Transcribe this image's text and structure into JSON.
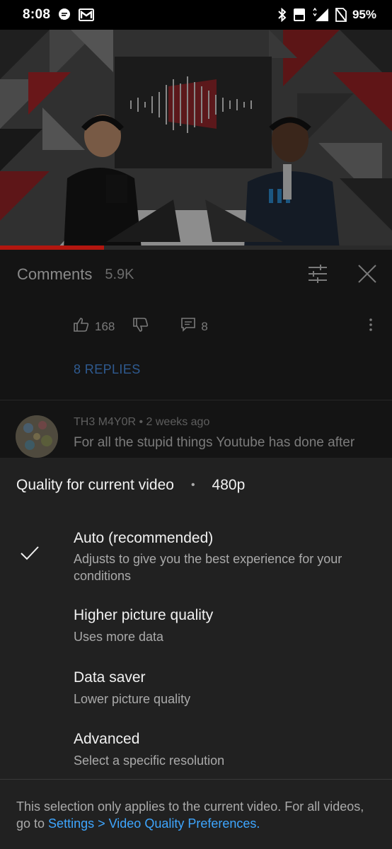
{
  "status_bar": {
    "time": "8:08",
    "battery": "95%",
    "icons": [
      "chat-bubble-icon",
      "gmail-icon",
      "bluetooth-icon",
      "volte-icon",
      "signal-4g-icon",
      "no-sim-icon"
    ]
  },
  "video": {
    "progress": 0.265
  },
  "comments": {
    "title": "Comments",
    "count": "5.9K",
    "likes": "168",
    "replies_count": "8",
    "replies_label": "8 REPLIES",
    "author_meta": "TH3 M4Y0R • 2 weeks ago",
    "text": "For all the stupid things Youtube has done after"
  },
  "quality_sheet": {
    "header": "Quality for current video",
    "dot": "•",
    "current": "480p",
    "options": [
      {
        "title": "Auto (recommended)",
        "desc": "Adjusts to give you the best experience for your conditions",
        "selected": true
      },
      {
        "title": "Higher picture quality",
        "desc": "Uses more data",
        "selected": false
      },
      {
        "title": "Data saver",
        "desc": "Lower picture quality",
        "selected": false
      },
      {
        "title": "Advanced",
        "desc": "Select a specific resolution",
        "selected": false
      }
    ],
    "footer_text": "This selection only applies to the current video. For all videos, go to ",
    "footer_link": "Settings > Video Quality Preferences."
  },
  "colors": {
    "accent_red": "#b3160f",
    "link_blue": "#3ea6ff"
  }
}
